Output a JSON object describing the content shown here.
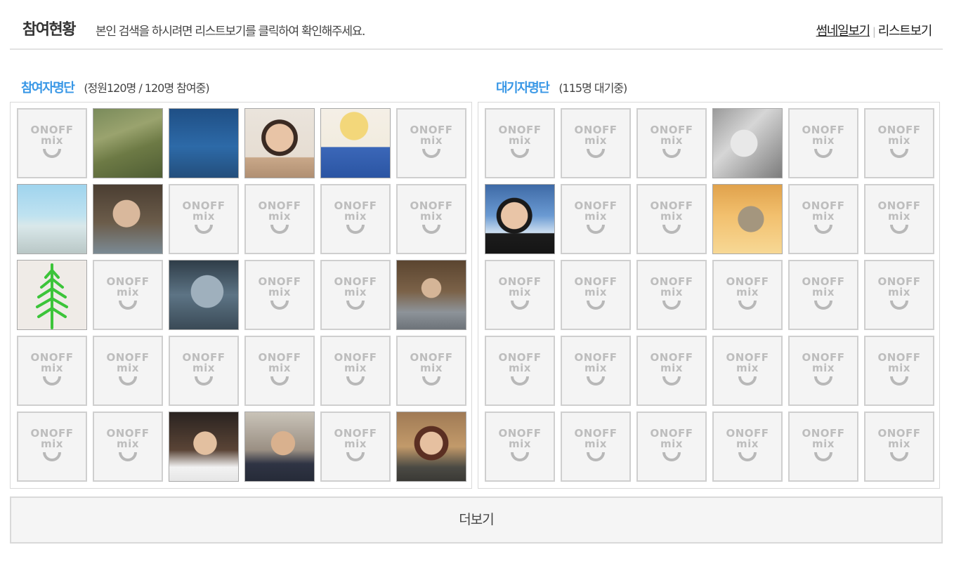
{
  "header": {
    "title": "참여현황",
    "description": "본인 검색을 하시려면 리스트보기를 클릭하여 확인해주세요.",
    "thumbnail_view_label": "썸네일보기",
    "separator": "|",
    "list_view_label": "리스트보기"
  },
  "participants": {
    "title": "참여자명단",
    "count_text": "(정원120명 / 120명 참여중)",
    "cells": [
      {
        "kind": "default"
      },
      {
        "kind": "photo",
        "icon": "garden-photo"
      },
      {
        "kind": "photo",
        "icon": "cloud-touch-photo"
      },
      {
        "kind": "photo",
        "icon": "man-portrait-photo"
      },
      {
        "kind": "photo",
        "icon": "cartoon-character-photo"
      },
      {
        "kind": "default"
      },
      {
        "kind": "photo",
        "icon": "beach-selfie-photo"
      },
      {
        "kind": "photo",
        "icon": "smiling-man-photo"
      },
      {
        "kind": "default"
      },
      {
        "kind": "default"
      },
      {
        "kind": "default"
      },
      {
        "kind": "default"
      },
      {
        "kind": "photo",
        "icon": "green-tree-photo"
      },
      {
        "kind": "default"
      },
      {
        "kind": "photo",
        "icon": "grayscale-face-photo"
      },
      {
        "kind": "default"
      },
      {
        "kind": "default"
      },
      {
        "kind": "photo",
        "icon": "cafe-person-photo"
      },
      {
        "kind": "default"
      },
      {
        "kind": "default"
      },
      {
        "kind": "default"
      },
      {
        "kind": "default"
      },
      {
        "kind": "default"
      },
      {
        "kind": "default"
      },
      {
        "kind": "default"
      },
      {
        "kind": "default"
      },
      {
        "kind": "photo",
        "icon": "night-selfie-photo"
      },
      {
        "kind": "photo",
        "icon": "airplane-selfie-photo"
      },
      {
        "kind": "default"
      },
      {
        "kind": "photo",
        "icon": "glasses-person-photo"
      }
    ]
  },
  "waitlist": {
    "title": "대기자명단",
    "count_text": "(115명 대기중)",
    "cells": [
      {
        "kind": "default"
      },
      {
        "kind": "default"
      },
      {
        "kind": "default"
      },
      {
        "kind": "photo",
        "icon": "sketch-portrait-photo"
      },
      {
        "kind": "default"
      },
      {
        "kind": "default"
      },
      {
        "kind": "photo",
        "icon": "boy-portrait-photo"
      },
      {
        "kind": "default"
      },
      {
        "kind": "default"
      },
      {
        "kind": "photo",
        "icon": "kitten-photo"
      },
      {
        "kind": "default"
      },
      {
        "kind": "default"
      },
      {
        "kind": "default"
      },
      {
        "kind": "default"
      },
      {
        "kind": "default"
      },
      {
        "kind": "default"
      },
      {
        "kind": "default"
      },
      {
        "kind": "default"
      },
      {
        "kind": "default"
      },
      {
        "kind": "default"
      },
      {
        "kind": "default"
      },
      {
        "kind": "default"
      },
      {
        "kind": "default"
      },
      {
        "kind": "default"
      },
      {
        "kind": "default"
      },
      {
        "kind": "default"
      },
      {
        "kind": "default"
      },
      {
        "kind": "default"
      },
      {
        "kind": "default"
      },
      {
        "kind": "default"
      }
    ]
  },
  "default_avatar": {
    "line1": "ONOFF",
    "line2": "mix",
    "icon": "onoffmix-logo-icon"
  },
  "more_button_label": "더보기",
  "colors": {
    "accent": "#3897e6",
    "border": "#d9d9d9",
    "avatar_bg": "#f4f4f4",
    "logo_gray": "#bdbdbd"
  }
}
